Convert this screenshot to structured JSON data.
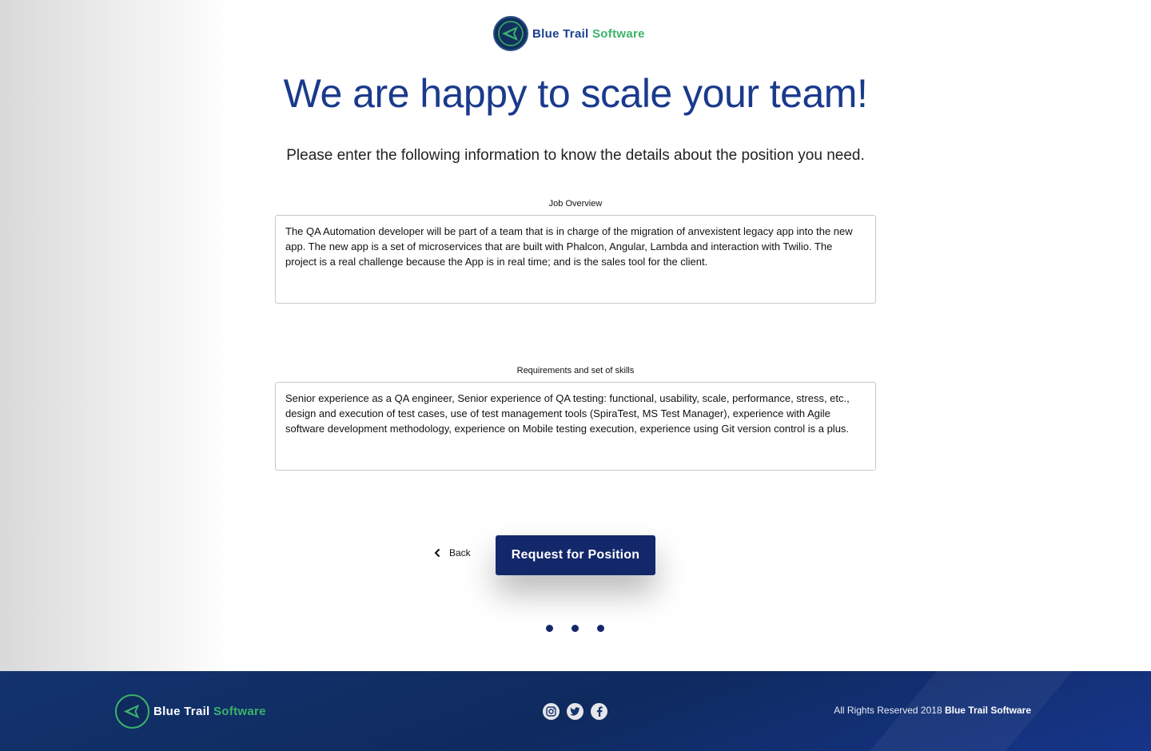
{
  "header": {
    "brand_primary": "Blue Trail",
    "brand_secondary": "Software",
    "logo_icon": "blue-trail-logo-icon"
  },
  "hero": {
    "title": "We are happy to scale your team!",
    "subtitle": "Please enter the following information to know the details about the position you need."
  },
  "form": {
    "job_overview": {
      "label": "Job Overview",
      "value": "The QA Automation developer will be part of a team that is in charge of the migration of anvexistent legacy app into the new app. The new app is a set of microservices that are built with Phalcon, Angular, Lambda and interaction with Twilio. The project is a real challenge because the App is in real time; and is the sales tool for the client."
    },
    "requirements": {
      "label": "Requirements and set of skills",
      "value": "Senior experience as a QA engineer, Senior experience of QA testing: functional, usability, scale, performance, stress, etc., design and execution of test cases, use of test management tools (SpiraTest, MS Test Manager), experience with Agile software development methodology, experience on Mobile testing execution, experience using Git version control is a plus."
    }
  },
  "actions": {
    "back_label": "Back",
    "submit_label": "Request for Position"
  },
  "pagination": {
    "steps": 3
  },
  "footer": {
    "brand_primary": "Blue Trail",
    "brand_secondary": "Software",
    "social_icons": [
      "instagram-icon",
      "twitter-icon",
      "facebook-icon"
    ],
    "copyright_prefix": "All Rights Reserved 2018",
    "copyright_brand": "Blue Trail Software"
  },
  "colors": {
    "primary": "#13286b",
    "heading": "#1a3a8c",
    "accent_green": "#3bb36b",
    "footer_bg": "#13336e"
  }
}
